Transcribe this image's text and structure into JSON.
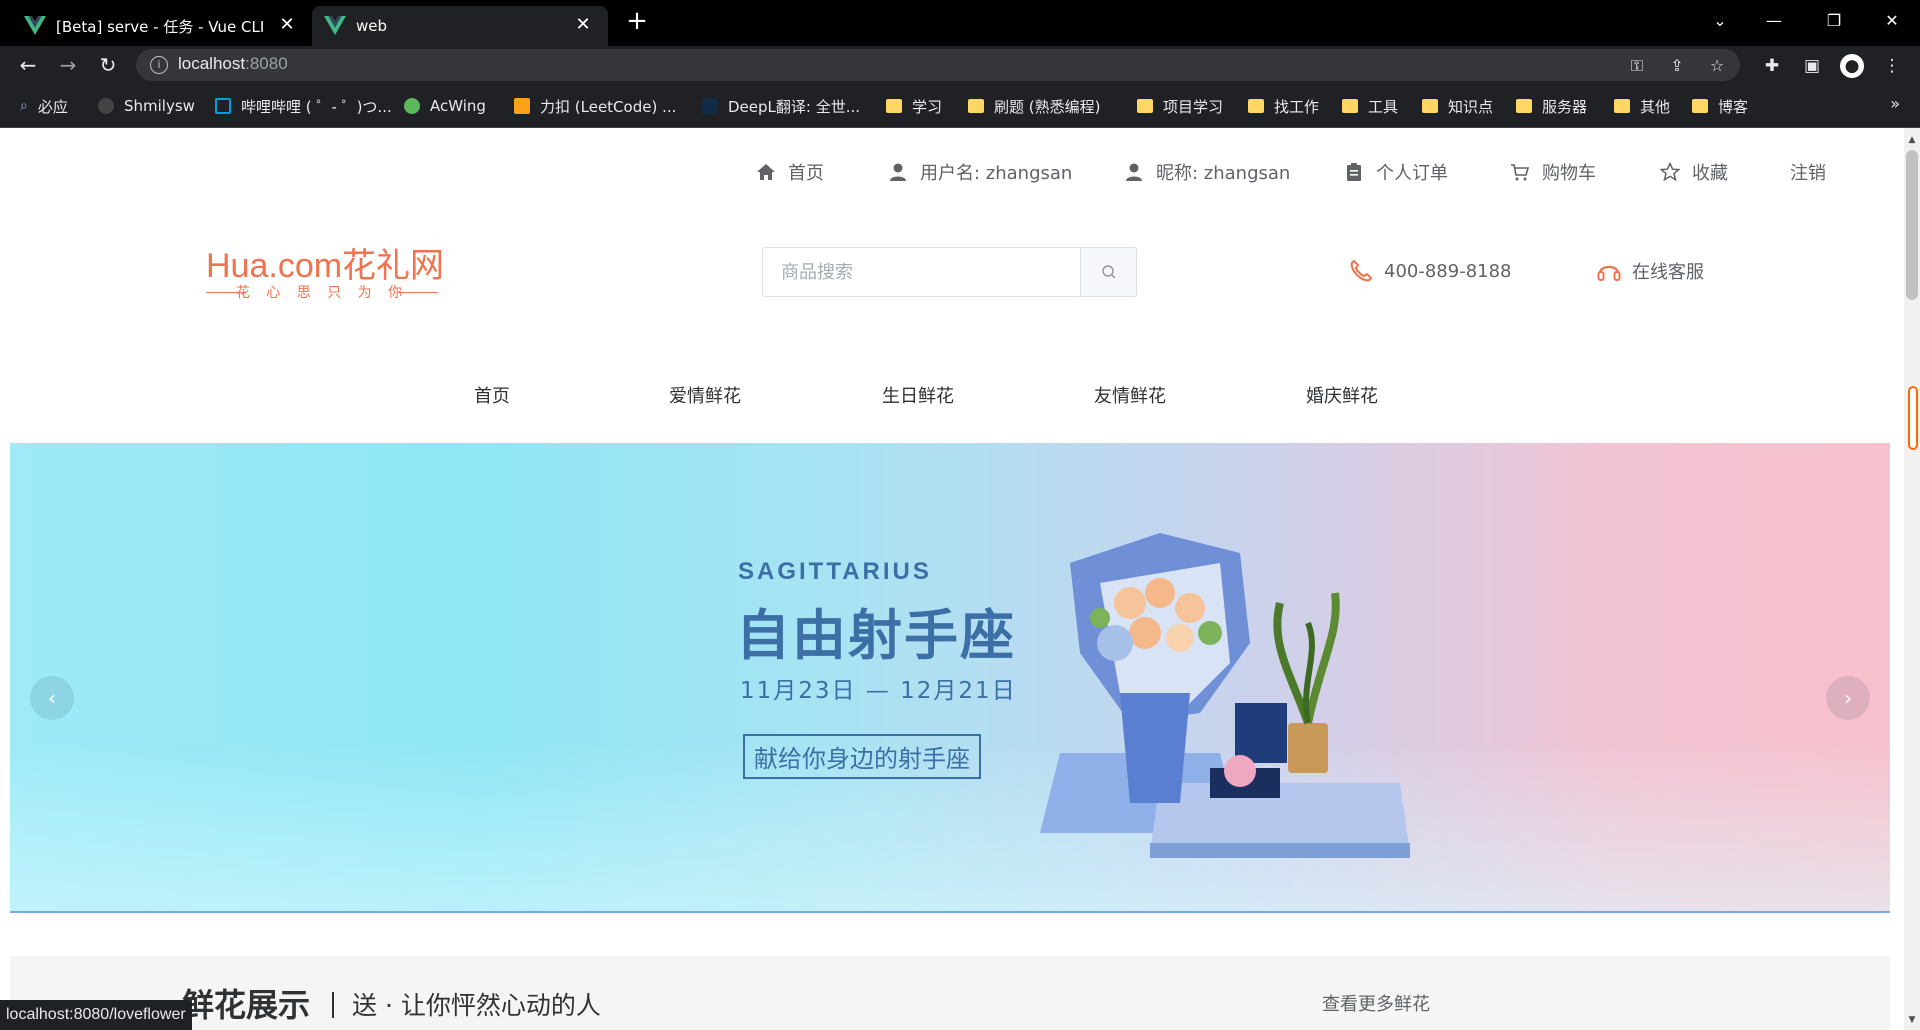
{
  "browser": {
    "tabs": [
      {
        "title": "[Beta] serve - 任务 - Vue CLI",
        "active": false
      },
      {
        "title": "web",
        "active": true
      }
    ],
    "url_host": "localhost",
    "url_port": ":8080",
    "bookmarks": [
      {
        "label": "必应",
        "icon": "search-icon"
      },
      {
        "label": "Shmilysw",
        "icon": "github-icon"
      },
      {
        "label": "哔哩哔哩 ( ゜- ゜)つ...",
        "icon": "bilibili-icon"
      },
      {
        "label": "AcWing",
        "icon": "acwing-icon"
      },
      {
        "label": "力扣 (LeetCode) ...",
        "icon": "leetcode-icon"
      },
      {
        "label": "DeepL翻译: 全世...",
        "icon": "deepl-icon"
      },
      {
        "label": "学习",
        "icon": "folder-icon"
      },
      {
        "label": "刷题 (熟悉编程)",
        "icon": "folder-icon"
      },
      {
        "label": "项目学习",
        "icon": "folder-icon"
      },
      {
        "label": "找工作",
        "icon": "folder-icon"
      },
      {
        "label": "工具",
        "icon": "folder-icon"
      },
      {
        "label": "知识点",
        "icon": "folder-icon"
      },
      {
        "label": "服务器",
        "icon": "folder-icon"
      },
      {
        "label": "其他",
        "icon": "folder-icon"
      },
      {
        "label": "博客",
        "icon": "folder-icon"
      }
    ],
    "status_url": "localhost:8080/loveflower"
  },
  "topnav": {
    "home": "首页",
    "username": "用户名: zhangsan",
    "nickname": "昵称: zhangsan",
    "orders": "个人订单",
    "cart": "购物车",
    "favorites": "收藏",
    "logout": "注销"
  },
  "logo": {
    "main": "Hua.com花礼网",
    "slogan": "花 心 思 只 为 你"
  },
  "search": {
    "placeholder": "商品搜索"
  },
  "contact": {
    "phone": "400-889-8188",
    "service": "在线客服"
  },
  "mainnav": [
    "首页",
    "爱情鲜花",
    "生日鲜花",
    "友情鲜花",
    "婚庆鲜花"
  ],
  "banner": {
    "en_title": "SAGITTARIUS",
    "cn_title": "自由射手座",
    "dates": "11月23日 — 12月21日",
    "tagline": "献给你身边的射手座"
  },
  "section": {
    "title": "鲜花展示",
    "subtitle": "送 · 让你怦然心动的人",
    "more": "查看更多鲜花"
  },
  "colors": {
    "brand": "#f0734e",
    "banner_text": "#3c6fa6",
    "chrome_dark": "#202124"
  }
}
